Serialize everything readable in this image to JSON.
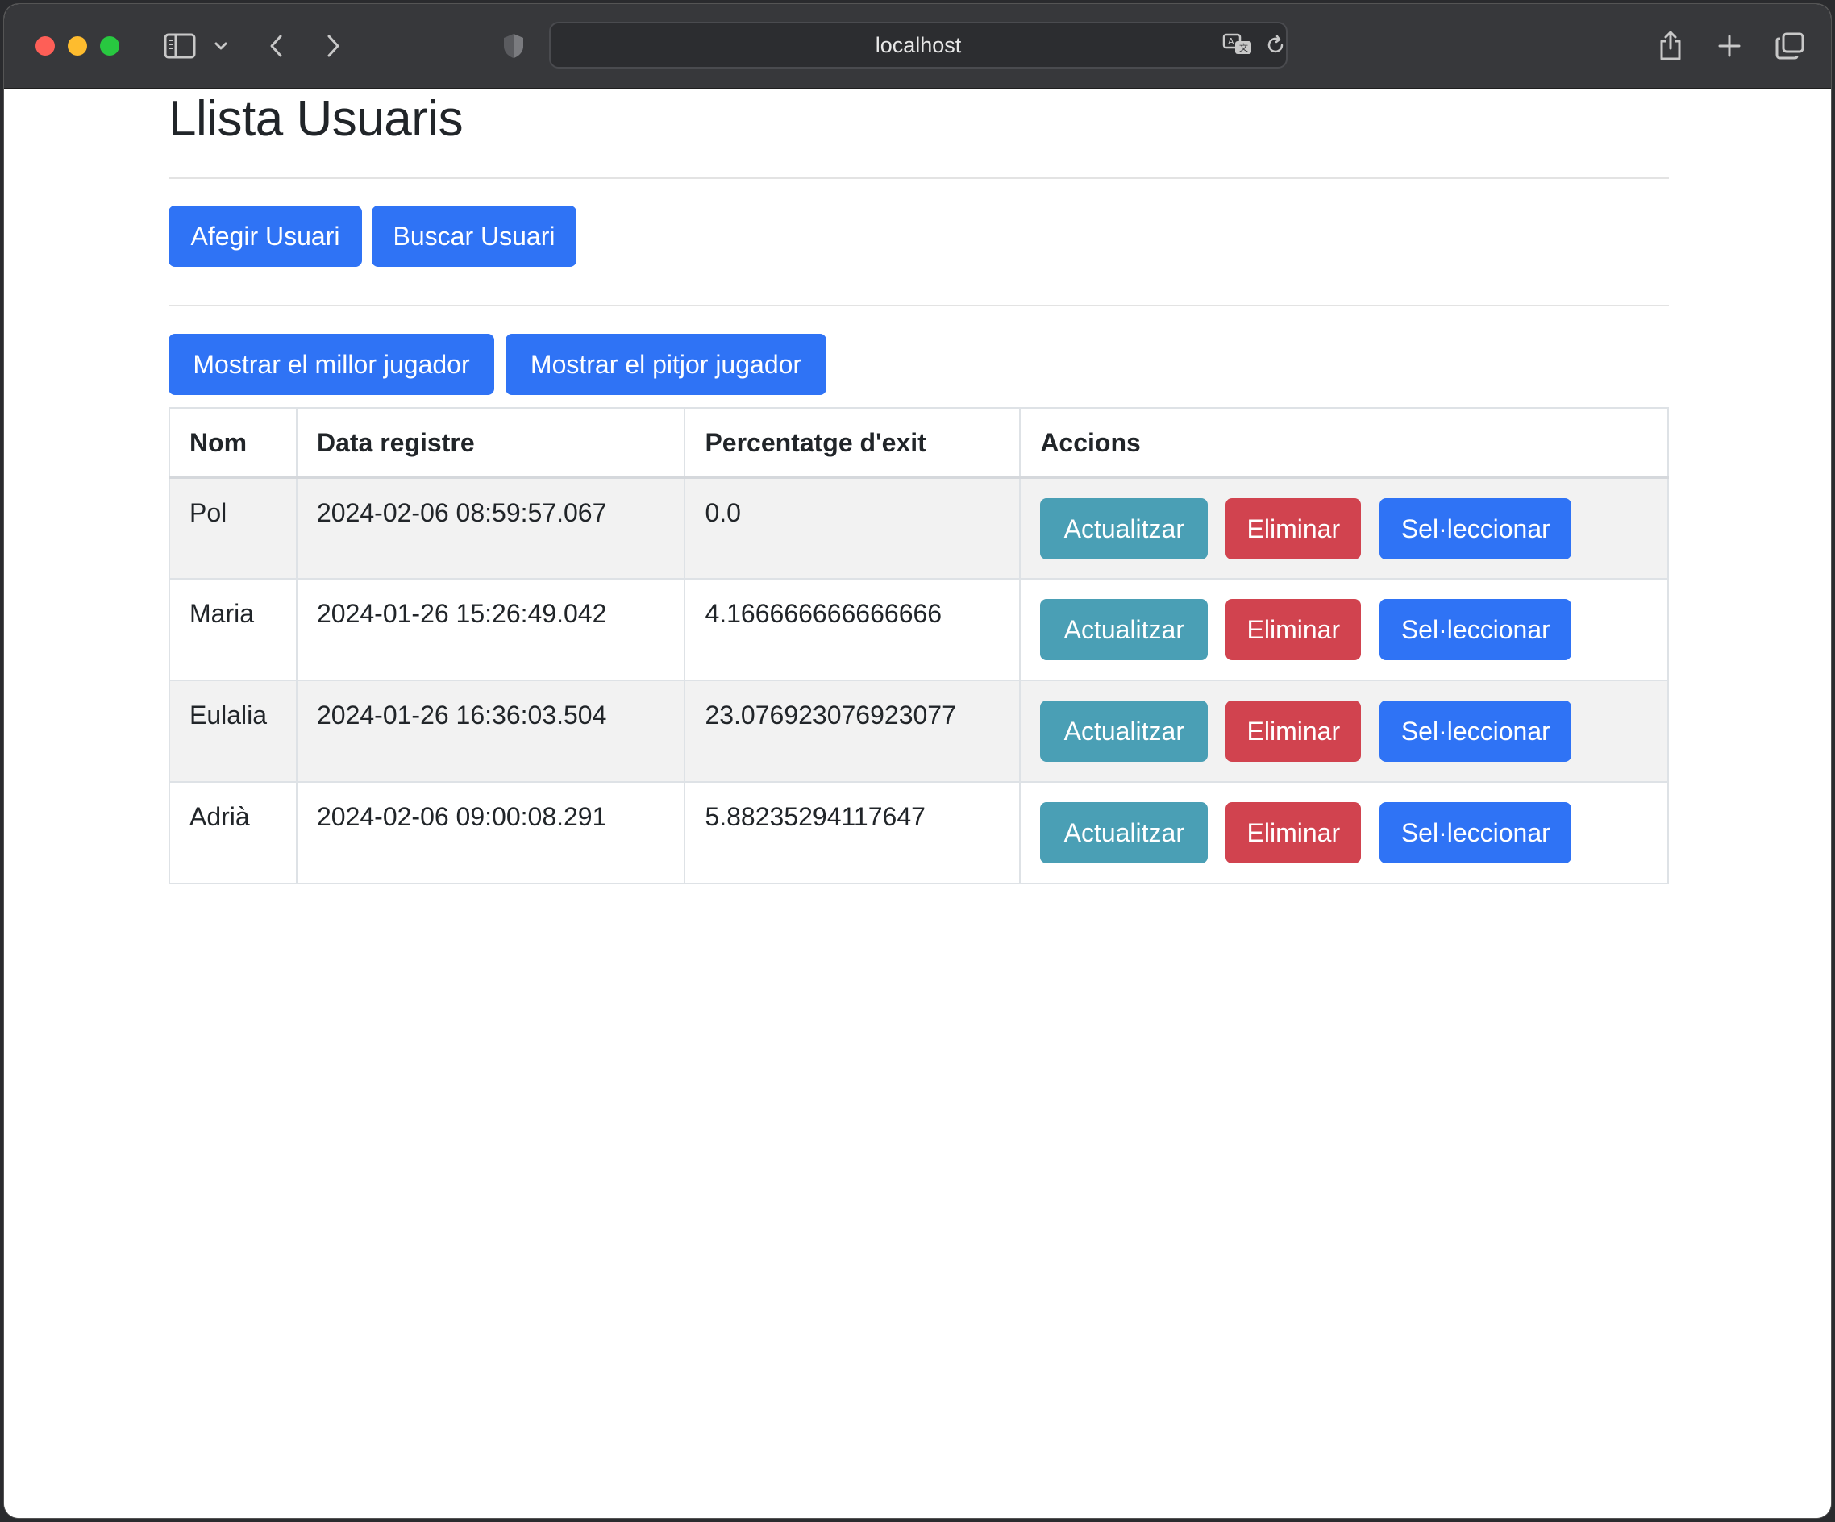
{
  "browser": {
    "address": "localhost"
  },
  "page": {
    "title": "Llista Usuaris",
    "buttons": {
      "add_user": "Afegir Usuari",
      "search_user": "Buscar Usuari",
      "best_player": "Mostrar el millor jugador",
      "worst_player": "Mostrar el pitjor jugador"
    },
    "table": {
      "headers": [
        "Nom",
        "Data registre",
        "Percentatge d'exit",
        "Accions"
      ],
      "rows": [
        {
          "name": "Pol",
          "date": "2024-02-06 08:59:57.067",
          "percent": "0.0"
        },
        {
          "name": "Maria",
          "date": "2024-01-26 15:26:49.042",
          "percent": "4.166666666666666"
        },
        {
          "name": "Eulalia",
          "date": "2024-01-26 16:36:03.504",
          "percent": "23.076923076923077"
        },
        {
          "name": "Adrià",
          "date": "2024-02-06 09:00:08.291",
          "percent": "5.88235294117647"
        }
      ],
      "actions": {
        "update": "Actualitzar",
        "delete": "Eliminar",
        "select": "Sel·leccionar"
      }
    }
  },
  "colors": {
    "primary": "#2f73f5",
    "info": "#4a9fb5",
    "danger": "#d1434f",
    "toolbar": "#37383b"
  },
  "icons": [
    "sidebar-icon",
    "chevron-down-icon",
    "back-icon",
    "forward-icon",
    "shield-icon",
    "translate-icon",
    "reload-icon",
    "share-icon",
    "new-tab-icon",
    "tabs-overview-icon"
  ]
}
